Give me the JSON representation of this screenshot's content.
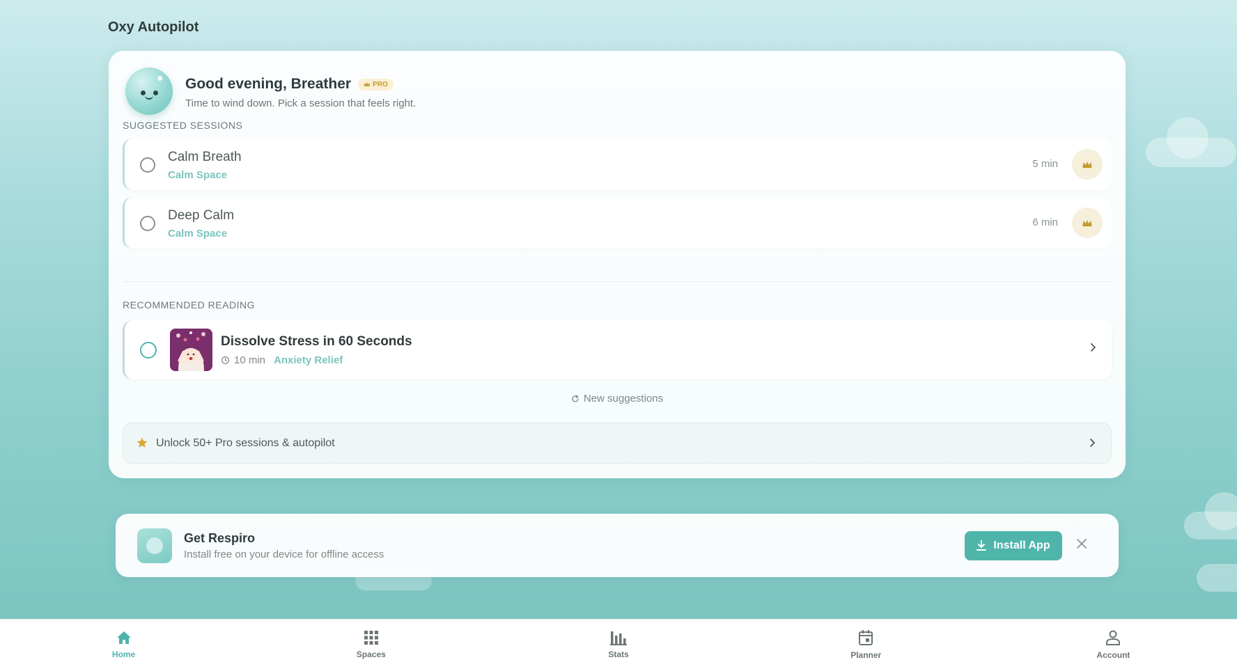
{
  "app_title": "Oxy Autopilot",
  "header": {
    "greeting": "Good evening, Breather",
    "badge": "PRO",
    "subtitle": "Time to wind down. Pick a session that feels right."
  },
  "sessions": {
    "label": "SUGGESTED SESSIONS",
    "items": [
      {
        "title": "Calm Breath",
        "space": "Calm Space",
        "duration": "5 min"
      },
      {
        "title": "Deep Calm",
        "space": "Calm Space",
        "duration": "6 min"
      }
    ]
  },
  "reading": {
    "label": "RECOMMENDED READING",
    "item": {
      "title": "Dissolve Stress in 60 Seconds",
      "duration": "10 min",
      "category": "Anxiety Relief"
    }
  },
  "new_suggestions": "New suggestions",
  "unlock": {
    "text": "Unlock 50+ Pro sessions & autopilot"
  },
  "install": {
    "name": "Get Respiro",
    "desc": "Install free on your device for offline access",
    "button": "Install App"
  },
  "nav": [
    {
      "label": "Home",
      "active": true
    },
    {
      "label": "Spaces"
    },
    {
      "label": "Stats"
    },
    {
      "label": "Planner"
    },
    {
      "label": "Account"
    }
  ],
  "colors": {
    "accent": "#4fb3ad",
    "gold": "#c49a2c",
    "text": "#2f3b3b"
  }
}
